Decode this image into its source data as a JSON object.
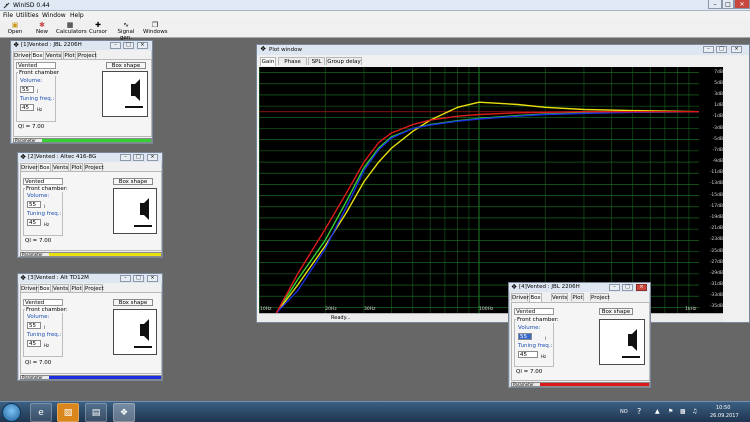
{
  "app": {
    "title": "WinISD 0.44",
    "window_controls": [
      "–",
      "□",
      "✕"
    ]
  },
  "menu": [
    "File",
    "Utilities",
    "Window",
    "Help"
  ],
  "toolbar": [
    {
      "label": "Open",
      "icon": "folder-icon"
    },
    {
      "label": "New",
      "icon": "new-icon"
    },
    {
      "label": "Calculators",
      "icon": "calculator-icon"
    },
    {
      "label": "Cursor",
      "icon": "crosshair-icon"
    },
    {
      "label": "Signal gen.",
      "icon": "signal-icon"
    },
    {
      "label": "Windows",
      "icon": "windows-icon"
    }
  ],
  "project_windows": [
    {
      "title": "[1]Vented : JBL 2206H",
      "tabs": [
        "Driver",
        "Box",
        "Vents",
        "Plot",
        "Project"
      ],
      "box_type": "Vented",
      "box_shape_label": "Box shape",
      "group_label": "Front chamber",
      "volume_label": "Volume:",
      "volume": "55",
      "volume_unit": "l",
      "tuning_label": "Tuning freq.:",
      "tuning": "45",
      "tuning_unit": "Hz",
      "ql": "Ql = 7.00",
      "param_label": "Parameter",
      "color": "#34d134"
    },
    {
      "title": "[2]Vented : Altec 416-8G",
      "tabs": [
        "Driver",
        "Box",
        "Vents",
        "Plot",
        "Project"
      ],
      "box_type": "Vented",
      "box_shape_label": "Box shape",
      "group_label": "Front chamber:",
      "volume_label": "Volume:",
      "volume": "55",
      "volume_unit": "l",
      "tuning_label": "Tuning freq.:",
      "tuning": "45",
      "tuning_unit": "Hz",
      "ql": "Ql = 7.00",
      "param_label": "Parameter",
      "color": "#e8e010"
    },
    {
      "title": "[3]Vented : Alt TD12M",
      "tabs": [
        "Driver",
        "Box",
        "Vents",
        "Plot",
        "Project"
      ],
      "box_type": "Vented",
      "box_shape_label": "Box shape",
      "group_label": "Front chamber:",
      "volume_label": "Volume:",
      "volume": "55",
      "volume_unit": "l",
      "tuning_label": "Tuning freq.:",
      "tuning": "45",
      "tuning_unit": "Hz",
      "ql": "Ql = 7.00",
      "param_label": "Parameter",
      "color": "#1a2ee0"
    },
    {
      "title": "[4]Vented : JBL 2206H",
      "tabs": [
        "Driver",
        "Box",
        "Vents",
        "Plot",
        "Project"
      ],
      "box_type": "Vented",
      "box_shape_label": "Box shape",
      "group_label": "Front chamber:",
      "volume_label": "Volume:",
      "volume": "55",
      "volume_unit": "l",
      "tuning_label": "Tuning freq.:",
      "tuning": "45",
      "tuning_unit": "Hz",
      "ql": "Ql = 7.00",
      "param_label": "Parameter",
      "color": "#dd1a1a"
    }
  ],
  "plot_window": {
    "title": "Plot window",
    "tabs": [
      "Gain",
      "Phase plot",
      "SPL",
      "Group delay"
    ],
    "status": "Ready...",
    "y_labels": [
      "7dB",
      "5dB",
      "3dB",
      "1dB",
      "-1dB",
      "-3dB",
      "-5dB",
      "-7dB",
      "-9dB",
      "-11dB",
      "-13dB",
      "-15dB",
      "-17dB",
      "-19dB",
      "-21dB",
      "-23dB",
      "-25dB",
      "-27dB",
      "-29dB",
      "-31dB",
      "-33dB",
      "-35dB"
    ],
    "x_labels": [
      "10Hz",
      "20Hz",
      "30Hz",
      "100Hz",
      "1kHz"
    ]
  },
  "chart_data": {
    "type": "line",
    "title": "",
    "xlabel": "",
    "ylabel": "",
    "x_scale": "log",
    "xlim": [
      10,
      1000
    ],
    "ylim": [
      -36,
      8
    ],
    "grid": true,
    "series": [
      {
        "color": "#34d134",
        "x": [
          12,
          15,
          20,
          25,
          30,
          35,
          40,
          50,
          60,
          80,
          100,
          150,
          200,
          300,
          500,
          1000
        ],
        "y": [
          -36,
          -30,
          -23,
          -16,
          -10,
          -6.5,
          -4.5,
          -3,
          -2.3,
          -1.6,
          -1.2,
          -0.7,
          -0.4,
          -0.2,
          -0.1,
          0
        ]
      },
      {
        "color": "#e8e010",
        "x": [
          12,
          15,
          20,
          25,
          30,
          35,
          40,
          50,
          60,
          80,
          100,
          150,
          200,
          300,
          500,
          1000
        ],
        "y": [
          -36,
          -31,
          -24,
          -18,
          -12.5,
          -9,
          -6.5,
          -3.5,
          -1.5,
          0.8,
          1.7,
          1.3,
          0.8,
          0.4,
          0.2,
          0
        ]
      },
      {
        "color": "#1a2ee0",
        "x": [
          12,
          15,
          20,
          25,
          30,
          35,
          40,
          50,
          60,
          80,
          100,
          150,
          200,
          300,
          500,
          1000
        ],
        "y": [
          -36,
          -32,
          -24.5,
          -17,
          -10.5,
          -6.8,
          -4.7,
          -3,
          -2.4,
          -1.7,
          -1.3,
          -0.8,
          -0.5,
          -0.3,
          -0.1,
          0
        ]
      },
      {
        "color": "#dd1a1a",
        "x": [
          12,
          15,
          20,
          25,
          30,
          35,
          40,
          50,
          60,
          80,
          100,
          150,
          200,
          300,
          500,
          1000
        ],
        "y": [
          -36,
          -29,
          -21,
          -14.5,
          -9,
          -5.5,
          -3.8,
          -2.3,
          -1.5,
          -0.8,
          -0.5,
          -0.2,
          -0.1,
          0,
          0,
          0
        ]
      }
    ]
  },
  "taskbar": {
    "lang": "NO",
    "time": "10:50",
    "date": "26.09.2017"
  }
}
